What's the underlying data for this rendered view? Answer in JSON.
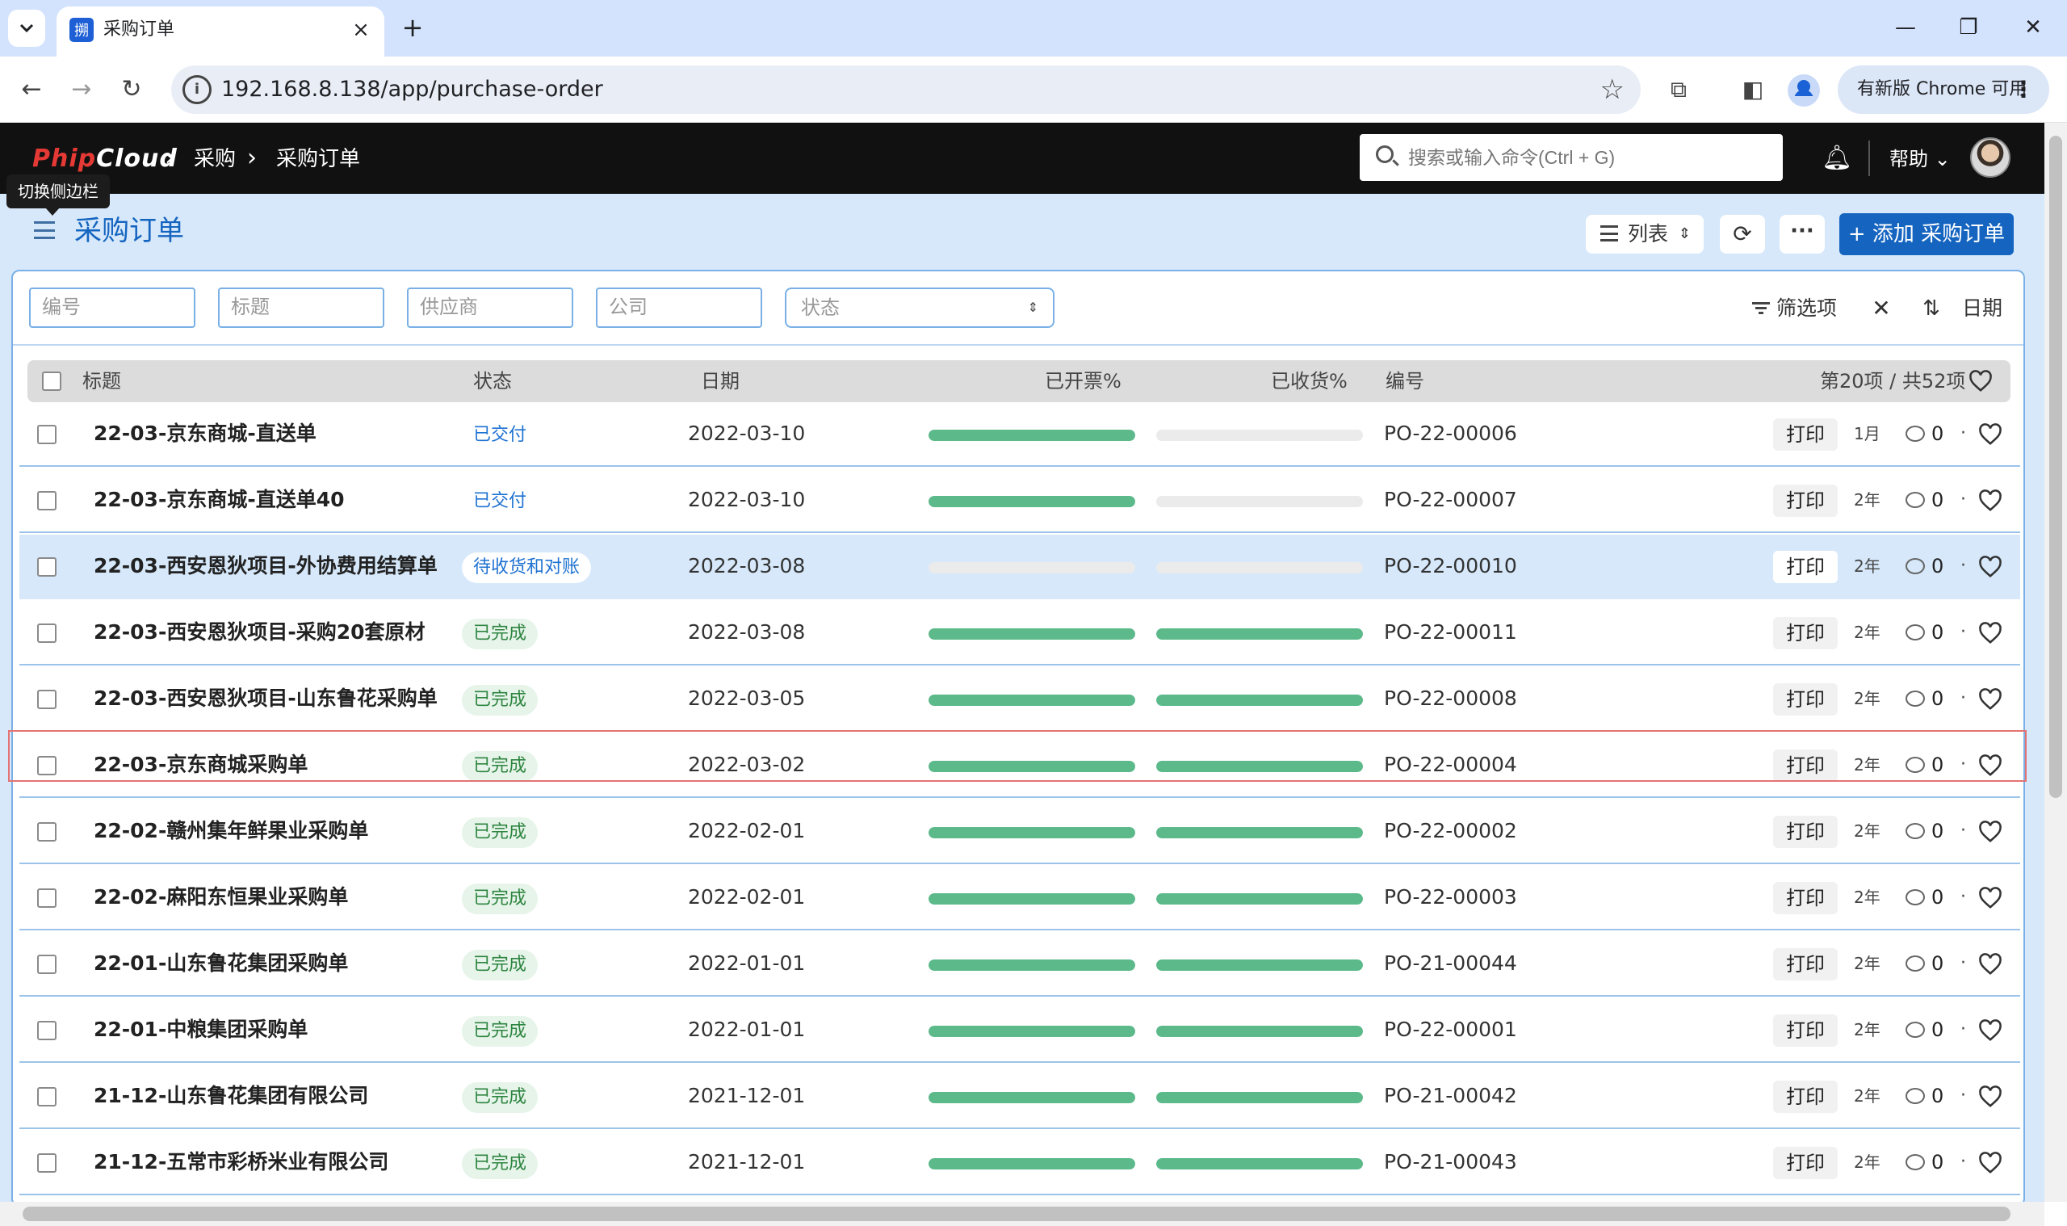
{
  "browser": {
    "tab_title": "采购订单",
    "tab_favicon": "搠",
    "url": "192.168.8.138/app/purchase-order",
    "update_label": "有新版 Chrome 可用"
  },
  "app": {
    "logo_part1": "Phip",
    "logo_part2": "Cloud",
    "breadcrumbs": [
      "采购",
      "采购订单"
    ],
    "search_placeholder": "搜索或输入命令(Ctrl + G)",
    "help_label": "帮助",
    "tooltip": "切换侧边栏"
  },
  "page": {
    "title": "采购订单",
    "view_label": "列表",
    "add_label": "+ 添加 采购订单"
  },
  "filters": {
    "code_placeholder": "编号",
    "title_placeholder": "标题",
    "supplier_placeholder": "供应商",
    "company_placeholder": "公司",
    "status_placeholder": "状态",
    "filter_label": "筛选项",
    "sort_label": "日期"
  },
  "table": {
    "headers": {
      "title": "标题",
      "status": "状态",
      "date": "日期",
      "billed": "已开票%",
      "received": "已收货%",
      "code": "编号",
      "count": "第20项 / 共52项"
    },
    "print_label": "打印",
    "rows": [
      {
        "title": "22-03-京东商城-直送单",
        "status": "已交付",
        "status_type": "blue",
        "date": "2022-03-10",
        "billed": 100,
        "received": 0,
        "code": "PO-22-00006",
        "age": "1月",
        "comments": "0"
      },
      {
        "title": "22-03-京东商城-直送单40",
        "status": "已交付",
        "status_type": "blue",
        "date": "2022-03-10",
        "billed": 100,
        "received": 0,
        "code": "PO-22-00007",
        "age": "2年",
        "comments": "0"
      },
      {
        "title": "22-03-西安恩狄项目-外协费用结算单",
        "status": "待收货和对账",
        "status_type": "pblue",
        "date": "2022-03-08",
        "billed": 0,
        "received": 0,
        "code": "PO-22-00010",
        "age": "2年",
        "comments": "0",
        "selected": true
      },
      {
        "title": "22-03-西安恩狄项目-采购20套原材",
        "status": "已完成",
        "status_type": "green",
        "date": "2022-03-08",
        "billed": 100,
        "received": 100,
        "code": "PO-22-00011",
        "age": "2年",
        "comments": "0"
      },
      {
        "title": "22-03-西安恩狄项目-山东鲁花采购单",
        "status": "已完成",
        "status_type": "green",
        "date": "2022-03-05",
        "billed": 100,
        "received": 100,
        "code": "PO-22-00008",
        "age": "2年",
        "comments": "0"
      },
      {
        "title": "22-03-京东商城采购单",
        "status": "已完成",
        "status_type": "green",
        "date": "2022-03-02",
        "billed": 100,
        "received": 100,
        "code": "PO-22-00004",
        "age": "2年",
        "comments": "0"
      },
      {
        "title": "22-02-赣州集年鲜果业采购单",
        "status": "已完成",
        "status_type": "green",
        "date": "2022-02-01",
        "billed": 100,
        "received": 100,
        "code": "PO-22-00002",
        "age": "2年",
        "comments": "0"
      },
      {
        "title": "22-02-麻阳东恒果业采购单",
        "status": "已完成",
        "status_type": "green",
        "date": "2022-02-01",
        "billed": 100,
        "received": 100,
        "code": "PO-22-00003",
        "age": "2年",
        "comments": "0"
      },
      {
        "title": "22-01-山东鲁花集团采购单",
        "status": "已完成",
        "status_type": "green",
        "date": "2022-01-01",
        "billed": 100,
        "received": 100,
        "code": "PO-21-00044",
        "age": "2年",
        "comments": "0"
      },
      {
        "title": "22-01-中粮集团采购单",
        "status": "已完成",
        "status_type": "green",
        "date": "2022-01-01",
        "billed": 100,
        "received": 100,
        "code": "PO-22-00001",
        "age": "2年",
        "comments": "0"
      },
      {
        "title": "21-12-山东鲁花集团有限公司",
        "status": "已完成",
        "status_type": "green",
        "date": "2021-12-01",
        "billed": 100,
        "received": 100,
        "code": "PO-21-00042",
        "age": "2年",
        "comments": "0"
      },
      {
        "title": "21-12-五常市彩桥米业有限公司",
        "status": "已完成",
        "status_type": "green",
        "date": "2021-12-01",
        "billed": 100,
        "received": 100,
        "code": "PO-21-00043",
        "age": "2年",
        "comments": "0"
      }
    ]
  }
}
